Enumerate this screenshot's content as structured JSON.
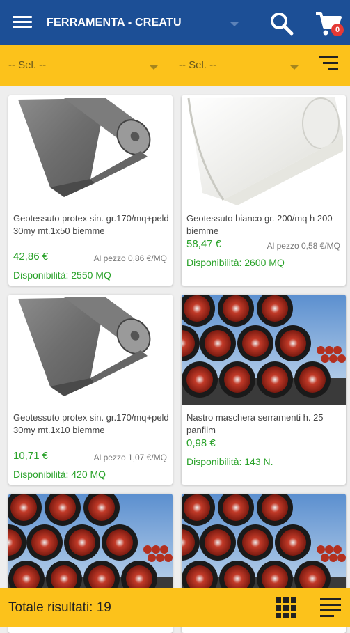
{
  "header": {
    "title": "FERRAMENTA - CREATU",
    "menu_icon": "hamburger-menu-icon",
    "search_icon": "search-icon",
    "cart_icon": "cart-icon",
    "cart_count": "0",
    "background": "#1c4f96"
  },
  "filters": {
    "select1": "-- Sel. --",
    "select2": "-- Sel. --",
    "sort_icon": "sort-icon",
    "background": "#fcc21b"
  },
  "products": [
    {
      "name": "Geotessuto protex sin. gr.170/mq+peld 30my mt.1x50 biemme",
      "price": "42,86 €",
      "unit_price": "Al pezzo 0,86 €/MQ",
      "availability": "Disponibilità: 2550 MQ",
      "image": "grey-roll-image"
    },
    {
      "name": "Geotessuto bianco gr. 200/mq h 200 biemme",
      "price": "58,47 €",
      "unit_price": "Al pezzo 0,58 €/MQ",
      "availability": "Disponibilità: 2600 MQ",
      "image": "white-roll-image"
    },
    {
      "name": "Geotessuto protex sin. gr.170/mq+peld 30my mt.1x10 biemme",
      "price": "10,71 €",
      "unit_price": "Al pezzo 1,07 €/MQ",
      "availability": "Disponibilità: 420 MQ",
      "image": "grey-roll-image"
    },
    {
      "name": "Nastro maschera serramenti h. 25 panfilm",
      "price": "0,98 €",
      "unit_price": "",
      "availability": "Disponibilità: 143 N.",
      "image": "pipes-image"
    },
    {
      "name": "",
      "price": "",
      "unit_price": "",
      "availability": "",
      "image": "pipes-image"
    },
    {
      "name": "",
      "price": "",
      "unit_price": "",
      "availability": "",
      "image": "pipes-image"
    }
  ],
  "footer": {
    "total": "Totale risultati: 19",
    "grid_icon": "grid-view-icon",
    "list_icon": "list-view-icon"
  },
  "colors": {
    "accent_green": "#2aa22a",
    "bar_yellow": "#fcc21b"
  }
}
